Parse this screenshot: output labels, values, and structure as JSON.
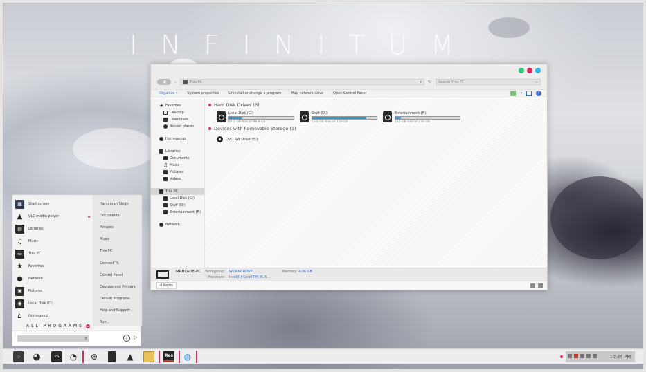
{
  "wallpaper": {
    "title": "INFINITUM"
  },
  "explorer": {
    "window_buttons": [
      {
        "name": "green-dot",
        "color": "#2ecc71"
      },
      {
        "name": "pink-dot",
        "color": "#e0245e"
      },
      {
        "name": "blue-dot",
        "color": "#2bb6e8"
      }
    ],
    "address": "This PC",
    "search_placeholder": "Search This PC",
    "toolbar": {
      "organize": "Organize",
      "system_properties": "System properties",
      "uninstall": "Uninstall or change a program",
      "map_drive": "Map network drive",
      "control_panel": "Open Control Panel"
    },
    "nav": {
      "favorites": "Favorites",
      "desktop": "Desktop",
      "downloads": "Downloads",
      "recent": "Recent places",
      "homegroup": "Homegroup",
      "libraries": "Libraries",
      "documents": "Documents",
      "music": "Music",
      "pictures": "Pictures",
      "videos": "Videos",
      "thispc": "This PC",
      "local_disk": "Local Disk (C:)",
      "stuff": "Stuff (D:)",
      "entertainment": "Entertainment (F:)",
      "network": "Network"
    },
    "sections": {
      "hdd": "Hard Disk Drives (3)",
      "removable": "Devices with Removable Storage (1)"
    },
    "drives": [
      {
        "name": "Local Disk (C:)",
        "free": "81.1 GB free of 99.9 GB",
        "used_fraction": 0.19
      },
      {
        "name": "Stuff (D:)",
        "free": "53.6 GB free of 329 GB",
        "used_fraction": 0.84
      },
      {
        "name": "Entertainment (F:)",
        "free": "215 GB free of 236 GB",
        "used_fraction": 0.09
      }
    ],
    "dvd": "DVD RW Drive (E:)",
    "details": {
      "pc_name": "MRBLADE-PC",
      "workgroup_label": "Workgroup:",
      "workgroup": "WORKGROUP",
      "memory_label": "Memory:",
      "memory": "4.00 GB",
      "processor_label": "Processor:",
      "processor": "Intel(R) Core(TM) i5-3..."
    },
    "status": {
      "items": "4 items"
    }
  },
  "start_menu": {
    "left": [
      {
        "label": "Start screen",
        "icon": "start-screen-icon"
      },
      {
        "label": "VLC media player",
        "icon": "vlc-icon"
      },
      {
        "label": "Libraries",
        "icon": "libraries-icon"
      },
      {
        "label": "Music",
        "icon": "music-icon"
      },
      {
        "label": "This PC",
        "icon": "computer-icon"
      },
      {
        "label": "Favorites",
        "icon": "star-icon"
      },
      {
        "label": "Network",
        "icon": "network-icon"
      },
      {
        "label": "Pictures",
        "icon": "pictures-icon"
      },
      {
        "label": "Local Disk (C:)",
        "icon": "disk-icon"
      },
      {
        "label": "Homegroup",
        "icon": "homegroup-icon"
      }
    ],
    "right": [
      "Harsimran Singh",
      "Documents",
      "Pictures",
      "Music",
      "This PC",
      "Connect To",
      "Control Panel",
      "Devices and Printers",
      "Default Programs",
      "Help and Support",
      "Run..."
    ],
    "all_programs": "ALL PROGRAMS"
  },
  "taskbar": {
    "clock": "10:34 PM",
    "res_label": "Res"
  }
}
